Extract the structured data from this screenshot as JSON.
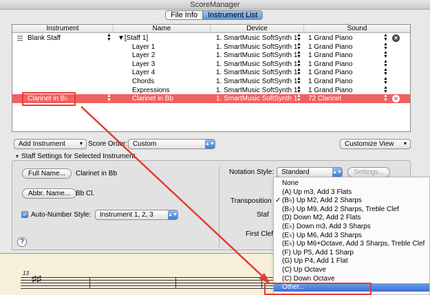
{
  "window": {
    "title": "ScoreManager"
  },
  "tabs": [
    {
      "label": "File Info",
      "active": false
    },
    {
      "label": "Instrument List",
      "active": true
    }
  ],
  "table": {
    "columns": [
      "Instrument",
      "Name",
      "Device",
      "Sound"
    ],
    "rows": [
      {
        "instrument": "Blank Staff",
        "name": "▼[Staff 1]",
        "device": "1. SmartMusic SoftSynth 1",
        "sound": "1 Grand Piano",
        "selected": false
      },
      {
        "instrument": "",
        "name": "Layer 1",
        "device": "1. SmartMusic SoftSynth 1",
        "sound": "1 Grand Piano",
        "selected": false
      },
      {
        "instrument": "",
        "name": "Layer 2",
        "device": "1. SmartMusic SoftSynth 1",
        "sound": "1 Grand Piano",
        "selected": false
      },
      {
        "instrument": "",
        "name": "Layer 3",
        "device": "1. SmartMusic SoftSynth 1",
        "sound": "1 Grand Piano",
        "selected": false
      },
      {
        "instrument": "",
        "name": "Layer 4",
        "device": "1. SmartMusic SoftSynth 1",
        "sound": "1 Grand Piano",
        "selected": false
      },
      {
        "instrument": "",
        "name": "Chords",
        "device": "1. SmartMusic SoftSynth 1",
        "sound": "1 Grand Piano",
        "selected": false
      },
      {
        "instrument": "",
        "name": "Expressions",
        "device": "1. SmartMusic SoftSynth 1",
        "sound": "1 Grand Piano",
        "selected": false
      },
      {
        "instrument": "Clarinet in B♭",
        "name": "Clarinet in Bb",
        "device": "1. SmartMusic SoftSynth 1",
        "sound": "72 Clarinet",
        "selected": true
      }
    ]
  },
  "toolbar": {
    "add_instrument": "Add Instrument",
    "score_order_label": "Score Order:",
    "score_order_value": "Custom",
    "customize_view": "Customize View"
  },
  "staff_settings": {
    "header": "Staff Settings for Selected Instrument",
    "full_name_button": "Full Name...",
    "full_name_value": "Clarinet in Bb",
    "abbr_name_button": "Abbr. Name...",
    "abbr_name_value": "Bb Cl.",
    "auto_number_label": "Auto-Number Style:",
    "auto_number_value": "Instrument 1, 2, 3",
    "notation_style_label": "Notation Style:",
    "notation_style_value": "Standard",
    "settings_button": "Settings...",
    "transposition_label": "Transposition",
    "staff_label": "Staf",
    "first_clef_label": "First Clef",
    "help": "?"
  },
  "transposition_menu": {
    "checked_index": 2,
    "highlighted_index": 13,
    "items": [
      "None",
      "(A) Up m3, Add 3 Flats",
      "(B♭) Up M2, Add 2 Sharps",
      "(B♭) Up M9, Add 2 Sharps, Treble Clef",
      "(D) Down M2, Add 2 Flats",
      "(E♭) Down m3, Add 3 Sharps",
      "(E♭) Up M6, Add 3 Sharps",
      "(E♭) Up M6+Octave, Add 3 Sharps, Treble Clef",
      "(F) Up P5, Add 1 Sharp",
      "(G) Up P4, Add 1 Flat",
      "(C) Up Octave",
      "(C) Down Octave",
      "Other..."
    ]
  },
  "score": {
    "measure_number": "13"
  },
  "colors": {
    "selected_row": "#f06060",
    "annotation": "#e53a30",
    "menu_highlight": "#3d6ed6"
  }
}
